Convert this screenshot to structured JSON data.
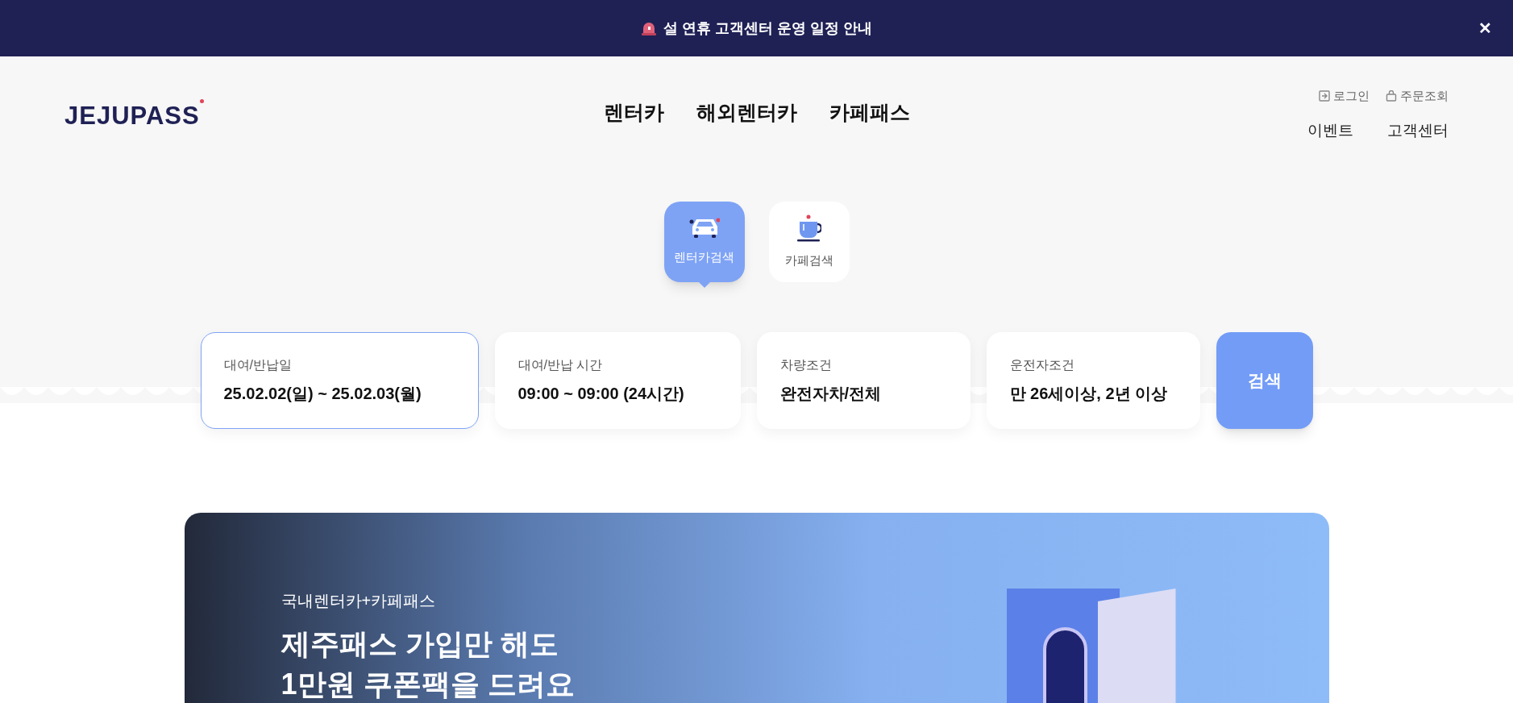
{
  "notice_bar": {
    "text": "설 연휴 고객센터 운영 일정 안내",
    "close": "✕"
  },
  "header": {
    "logo": {
      "text": "JEJUPASS"
    },
    "nav": [
      "렌터카",
      "해외렌터카",
      "카페패스"
    ],
    "utility_links": [
      {
        "kind": "login",
        "label": "로그인"
      },
      {
        "kind": "orders",
        "label": "주문조회"
      }
    ],
    "links": [
      "이벤트",
      "고객센터"
    ]
  },
  "search_tabs": [
    {
      "kind": "car",
      "label": "렌터카검색",
      "selected": true
    },
    {
      "kind": "cafe",
      "label": "카페검색",
      "selected": false
    }
  ],
  "search_fields": [
    {
      "label": "대여/반납일",
      "value": "25.02.02(일) ~ 25.02.03(월)",
      "selected": true
    },
    {
      "label": "대여/반납 시간",
      "value": "09:00 ~ 09:00 (24시간)",
      "selected": false
    },
    {
      "label": "차량조건",
      "value": "완전자차/전체",
      "selected": false
    },
    {
      "label": "운전자조건",
      "value": "만 26세이상, 2년 이상",
      "selected": false
    }
  ],
  "search_button": "검색",
  "banner": {
    "eyebrow": "국내렌터카+카페패스",
    "headline": [
      "제주패스 가입만 해도",
      "1만원 쿠폰팩을 드려요"
    ]
  }
}
